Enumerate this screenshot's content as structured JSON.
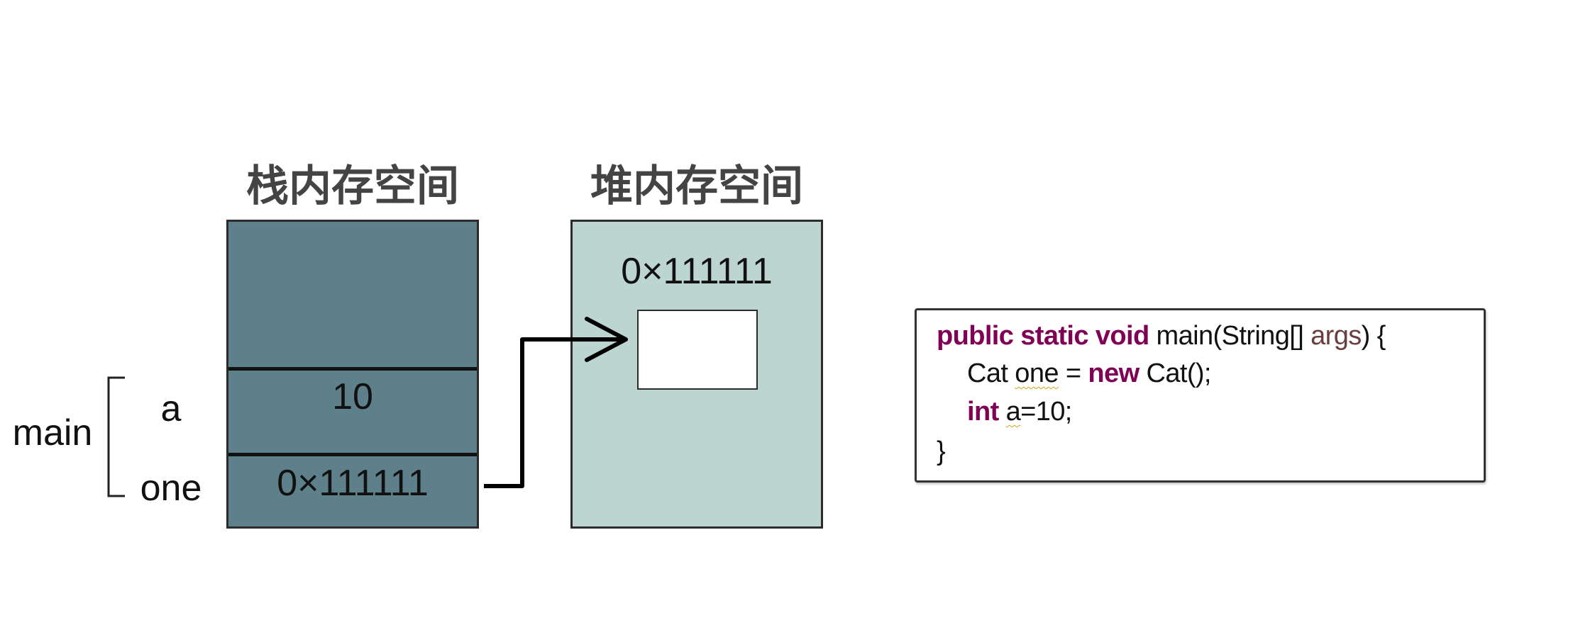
{
  "stack": {
    "title": "栈内存空间",
    "value_a": "10",
    "value_one": "0×111111"
  },
  "frame": {
    "label": "main",
    "var_a": "a",
    "var_one": "one"
  },
  "heap": {
    "title": "堆内存空间",
    "address": "0×111111"
  },
  "code": {
    "lines": [
      [
        {
          "t": "public static void",
          "k": "kw"
        },
        {
          "t": " main(String[] ",
          "k": "plain"
        },
        {
          "t": "args",
          "k": "param"
        },
        {
          "t": ") {",
          "k": "plain"
        }
      ],
      [
        {
          "t": "Cat ",
          "k": "plain"
        },
        {
          "t": "one",
          "k": "warn"
        },
        {
          "t": " = ",
          "k": "plain"
        },
        {
          "t": "new",
          "k": "kw"
        },
        {
          "t": " Cat();",
          "k": "plain"
        }
      ],
      [
        {
          "t": "int",
          "k": "kw"
        },
        {
          "t": " ",
          "k": "plain"
        },
        {
          "t": "a",
          "k": "warn"
        },
        {
          "t": "=10;",
          "k": "plain"
        }
      ],
      [
        {
          "t": "}",
          "k": "plain"
        }
      ]
    ]
  },
  "colors": {
    "stack_fill": "#5d808a",
    "heap_fill": "#bcd5d1",
    "keyword": "#7f0055",
    "parameter": "#6a3e3e",
    "warning_underline": "#d4a017"
  }
}
